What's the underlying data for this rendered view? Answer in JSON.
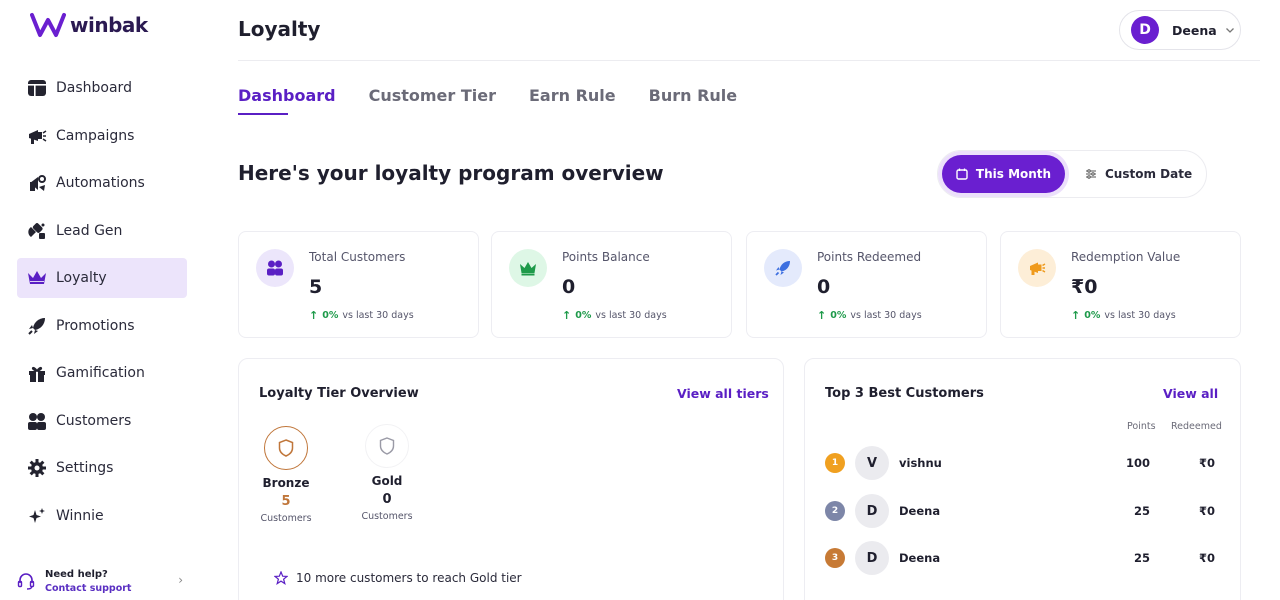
{
  "app": {
    "name": "winbak"
  },
  "sidebar": {
    "items": [
      {
        "label": "Dashboard",
        "icon": "dashboard-icon"
      },
      {
        "label": "Campaigns",
        "icon": "megaphone-icon"
      },
      {
        "label": "Automations",
        "icon": "automation-icon"
      },
      {
        "label": "Lead Gen",
        "icon": "magnet-icon"
      },
      {
        "label": "Loyalty",
        "icon": "crown-icon",
        "active": true
      },
      {
        "label": "Promotions",
        "icon": "rocket-icon"
      },
      {
        "label": "Gamification",
        "icon": "gift-icon"
      },
      {
        "label": "Customers",
        "icon": "users-icon"
      },
      {
        "label": "Settings",
        "icon": "gear-icon"
      },
      {
        "label": "Winnie",
        "icon": "sparkle-icon"
      }
    ],
    "help": {
      "title": "Need help?",
      "link": "Contact support"
    }
  },
  "header": {
    "title": "Loyalty",
    "user": {
      "initial": "D",
      "name": "Deena"
    }
  },
  "tabs": [
    {
      "label": "Dashboard",
      "active": true
    },
    {
      "label": "Customer Tier"
    },
    {
      "label": "Earn Rule"
    },
    {
      "label": "Burn Rule"
    }
  ],
  "overview": {
    "heading": "Here's your loyalty program overview",
    "date_filter": {
      "this_month": "This Month",
      "custom_date": "Custom Date",
      "selected": "This Month"
    }
  },
  "stats": [
    {
      "label": "Total Customers",
      "value": "5",
      "trend_pct": "0%",
      "trend_text": "vs last 30 days",
      "icon": "users-icon",
      "color": "#ece6fb"
    },
    {
      "label": "Points Balance",
      "value": "0",
      "trend_pct": "0%",
      "trend_text": "vs last 30 days",
      "icon": "crown-icon",
      "color": "#def7e6"
    },
    {
      "label": "Points Redeemed",
      "value": "0",
      "trend_pct": "0%",
      "trend_text": "vs last 30 days",
      "icon": "rocket-icon",
      "color": "#e4eafc"
    },
    {
      "label": "Redemption Value",
      "value": "₹0",
      "trend_pct": "0%",
      "trend_text": "vs last 30 days",
      "icon": "megaphone-icon",
      "color": "#fdeed7"
    }
  ],
  "tier_overview": {
    "title": "Loyalty Tier Overview",
    "link": "View all tiers",
    "tiers": [
      {
        "name": "Bronze",
        "count": "5",
        "sub": "Customers",
        "color": "#c0763a"
      },
      {
        "name": "Gold",
        "count": "0",
        "sub": "Customers",
        "color": "#1f1f2e"
      }
    ],
    "goal": "10 more customers to reach Gold tier"
  },
  "top_customers": {
    "title": "Top 3 Best Customers",
    "link": "View all",
    "columns": [
      "Points",
      "Redeemed"
    ],
    "rows": [
      {
        "rank": "1",
        "initial": "V",
        "name": "vishnu",
        "points": "100",
        "redeemed": "₹0",
        "rank_color": "#f0a020"
      },
      {
        "rank": "2",
        "initial": "D",
        "name": "Deena",
        "points": "25",
        "redeemed": "₹0",
        "rank_color": "#7d86a8"
      },
      {
        "rank": "3",
        "initial": "D",
        "name": "Deena",
        "points": "25",
        "redeemed": "₹0",
        "rank_color": "#c77a35"
      }
    ]
  },
  "colors": {
    "accent": "#6a1fd0",
    "accent_text": "#5a1fc4",
    "positive": "#1e9a4a"
  }
}
